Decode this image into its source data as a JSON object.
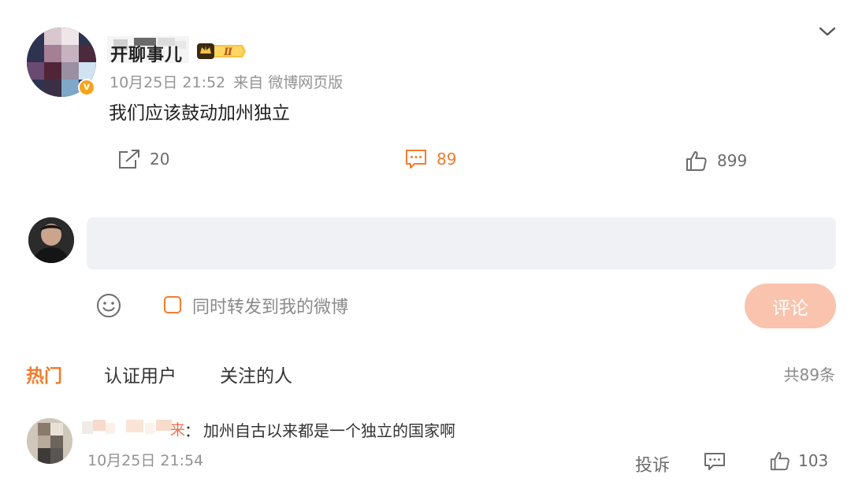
{
  "post": {
    "author_name": "开聊事儿",
    "level_badge": "Ⅱ",
    "verified_mark": "v",
    "timestamp": "10月25日 21:52",
    "source": "来自 微博网页版",
    "text": "我们应该鼓动加州独立",
    "actions": {
      "share_count": "20",
      "comment_count": "89",
      "like_count": "899"
    }
  },
  "composer": {
    "input_value": "",
    "repost_label": "同时转发到我的微博",
    "repost_checked": false,
    "submit_label": "评论"
  },
  "tabs": [
    "热门",
    "认证用户",
    "关注的人"
  ],
  "total_count": "共89条",
  "comments": [
    {
      "name_tail": "来",
      "separator": "：",
      "text": "加州自古以来都是一个独立的国家啊",
      "timestamp": "10月25日 21:54",
      "report_label": "投诉",
      "like_count": "103"
    }
  ],
  "icons": {
    "collapse": "chevron-down-icon",
    "share": "share-icon",
    "comment": "comment-icon",
    "like": "thumbs-up-icon",
    "emoji": "emoji-icon",
    "reply": "reply-icon"
  },
  "colors": {
    "accent": "#f07c2d",
    "submit_disabled": "#f9c3ad",
    "muted": "#939393",
    "input_bg": "#f0f1f4"
  }
}
